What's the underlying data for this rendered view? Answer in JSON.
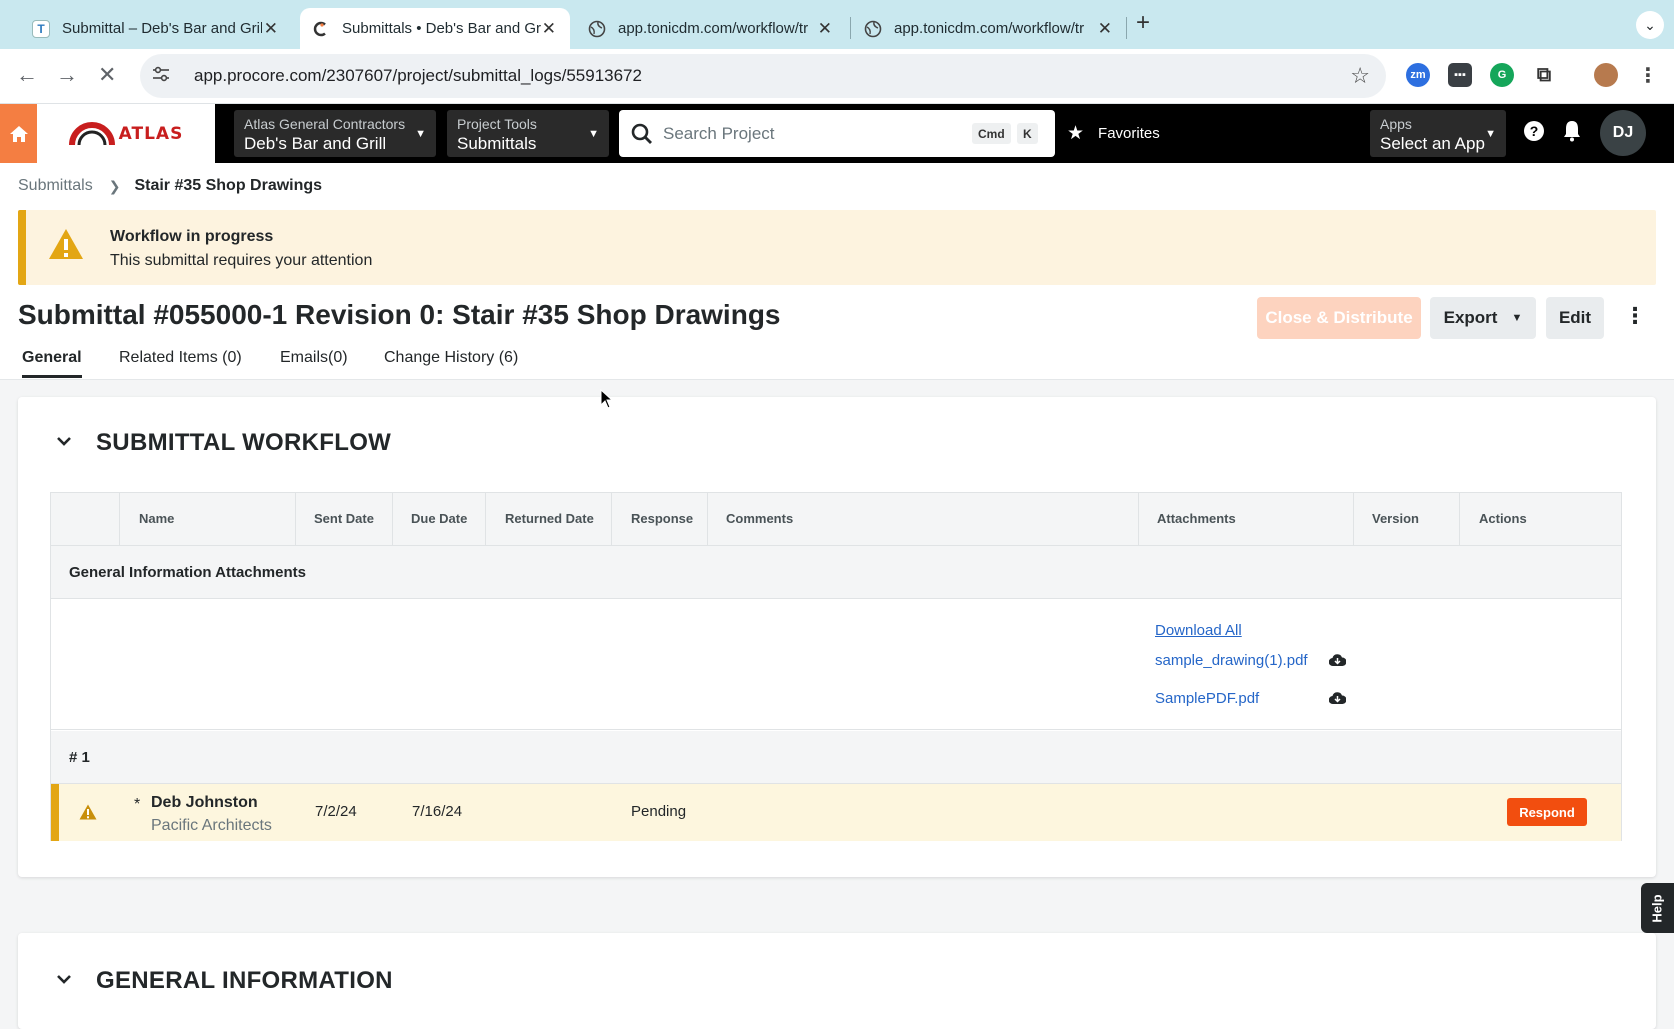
{
  "browser": {
    "tabs": [
      {
        "title": "Submittal – Deb's Bar and Grill",
        "favicon": "T"
      },
      {
        "title": "Submittals • Deb's Bar and Grill",
        "favicon": "procore-icon"
      },
      {
        "title": "app.tonicdm.com/workflow/tr",
        "favicon": "globe-icon"
      },
      {
        "title": "app.tonicdm.com/workflow/tr",
        "favicon": "globe-icon"
      }
    ],
    "url": "app.procore.com/2307607/project/submittal_logs/55913672"
  },
  "header": {
    "company_label": "Atlas General Contractors",
    "company_value": "Deb's Bar and Grill",
    "tools_label": "Project Tools",
    "tools_value": "Submittals",
    "search_placeholder": "Search Project",
    "kbd_cmd": "Cmd",
    "kbd_k": "K",
    "favorites": "Favorites",
    "apps_label": "Apps",
    "apps_value": "Select an App",
    "avatar_initials": "DJ",
    "logo_text": "ATLAS"
  },
  "breadcrumb": {
    "parent": "Submittals",
    "current": "Stair #35 Shop Drawings"
  },
  "banner": {
    "title": "Workflow in progress",
    "subtitle": "This submittal requires your attention"
  },
  "page": {
    "title": "Submittal #055000-1 Revision 0: Stair #35 Shop Drawings",
    "buttons": {
      "close_distribute": "Close & Distribute",
      "export": "Export",
      "edit": "Edit"
    },
    "tabs": [
      "General",
      "Related Items (0)",
      "Emails(0)",
      "Change History (6)"
    ]
  },
  "workflow": {
    "section_title": "SUBMITTAL WORKFLOW",
    "columns": [
      "Name",
      "Sent Date",
      "Due Date",
      "Returned Date",
      "Response",
      "Comments",
      "Attachments",
      "Version",
      "Actions"
    ],
    "general_group": "General Information Attachments",
    "attachments": {
      "download_all": "Download All",
      "files": [
        "sample_drawing(1).pdf",
        "SamplePDF.pdf"
      ]
    },
    "step_group": "# 1",
    "steps": [
      {
        "required": "*",
        "name": "Deb Johnston",
        "company": "Pacific Architects",
        "sent_date": "7/2/24",
        "due_date": "7/16/24",
        "response": "Pending",
        "action": "Respond"
      }
    ]
  },
  "general_info": {
    "section_title": "GENERAL INFORMATION"
  },
  "help_tab": "Help",
  "colors": {
    "tab_strip": "#c9e8ef",
    "procore_orange": "#f47e42",
    "warning": "#e3a614",
    "respond": "#f24e0f",
    "link": "#2566c8"
  }
}
